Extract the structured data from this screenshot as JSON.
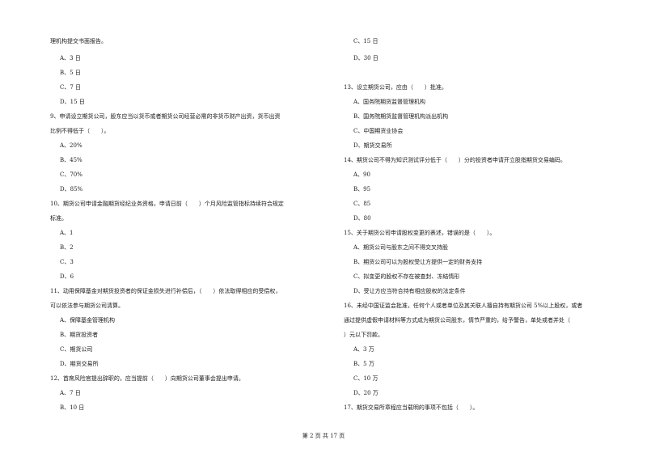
{
  "left_column": [
    {
      "type": "text",
      "text": "理机构提交书面报告。"
    },
    {
      "type": "option",
      "text": "A、3 日"
    },
    {
      "type": "option",
      "text": "B、5 日"
    },
    {
      "type": "option",
      "text": "C、7 日"
    },
    {
      "type": "option",
      "text": "D、15 日"
    },
    {
      "type": "question",
      "text": "9、申请设立期货公司，股东应当以货币或者期货公司经营必需的非货币财产出资，货币出资"
    },
    {
      "type": "text",
      "text": "比例不得低于（　　）。"
    },
    {
      "type": "option",
      "text": "A、20%"
    },
    {
      "type": "option",
      "text": "B、45%"
    },
    {
      "type": "option",
      "text": "C、70%"
    },
    {
      "type": "option",
      "text": "D、85%"
    },
    {
      "type": "question",
      "text": "10、期货公司申请金融期货经纪业务资格，申请日前（　　）个月风险监管指标持续符合规定"
    },
    {
      "type": "text",
      "text": "标准。"
    },
    {
      "type": "option",
      "text": "A、1"
    },
    {
      "type": "option",
      "text": "B、2"
    },
    {
      "type": "option",
      "text": "C、3"
    },
    {
      "type": "option",
      "text": "D、6"
    },
    {
      "type": "question",
      "text": "11、动用保障基金对期货投资者的保证金损失进行补偿后，（　　）依法取得相应的受偿权，"
    },
    {
      "type": "text",
      "text": "可以依法参与期货公司清算。"
    },
    {
      "type": "option",
      "text": "A、保障基金管理机构"
    },
    {
      "type": "option",
      "text": "B、期货投资者"
    },
    {
      "type": "option",
      "text": "C、期货公司"
    },
    {
      "type": "option",
      "text": "D、期货交易所"
    },
    {
      "type": "question",
      "text": "12、首席风险官提出辞职的，应当提前（　　）向期货公司董事会提出申请。"
    },
    {
      "type": "option",
      "text": "A、7 日"
    },
    {
      "type": "option",
      "text": "B、10 日"
    }
  ],
  "right_column": [
    {
      "type": "option",
      "text": "C、15 日"
    },
    {
      "type": "option",
      "text": "D、30 日"
    },
    {
      "type": "question",
      "text": "13、设立期货公司，应由（　　）批准。"
    },
    {
      "type": "option",
      "text": "A、国务院期货监督管理机构"
    },
    {
      "type": "option",
      "text": "B、国务院期货监督管理机构派出机构"
    },
    {
      "type": "option",
      "text": "C、中国期货业协会"
    },
    {
      "type": "option",
      "text": "D、期货交易所"
    },
    {
      "type": "question",
      "text": "14、期货公司不得为知识测试评分低于（　　）分的投资者申请开立股指期货交易编码。"
    },
    {
      "type": "option",
      "text": "A、90"
    },
    {
      "type": "option",
      "text": "B、95"
    },
    {
      "type": "option",
      "text": "C、85"
    },
    {
      "type": "option",
      "text": "D、80"
    },
    {
      "type": "question",
      "text": "15、关于期货公司申请股权变更的表述，错误的是（　　）。"
    },
    {
      "type": "option",
      "text": "A、期货公司与股东之间不得交叉持股"
    },
    {
      "type": "option",
      "text": "B、期货公司可以为股权受让方提供一定的财务支持"
    },
    {
      "type": "option",
      "text": "C、拟变更的股权不存在被查封、冻结情形"
    },
    {
      "type": "option",
      "text": "D、受让方应当符合持有相应股权的法定条件"
    },
    {
      "type": "question",
      "text": "16、未经中国证监会批准，任何个人或者单位及其关联人擅自持有期货公司 5%以上股权，或者"
    },
    {
      "type": "text",
      "text": "通过提供虚假申请材料等方式成为期货公司股东，情节严重的，给予警告，单处或者并处（"
    },
    {
      "type": "text",
      "text": "）元以下罚款。"
    },
    {
      "type": "option",
      "text": "A、3 万"
    },
    {
      "type": "option",
      "text": "B、5 万"
    },
    {
      "type": "option",
      "text": "C、10 万"
    },
    {
      "type": "option",
      "text": "D、20 万"
    },
    {
      "type": "question",
      "text": "17、期货交易所章程应当载明的事项不包括（　　）。"
    }
  ],
  "footer": {
    "page_label": "第 2 页 共 17 页"
  }
}
